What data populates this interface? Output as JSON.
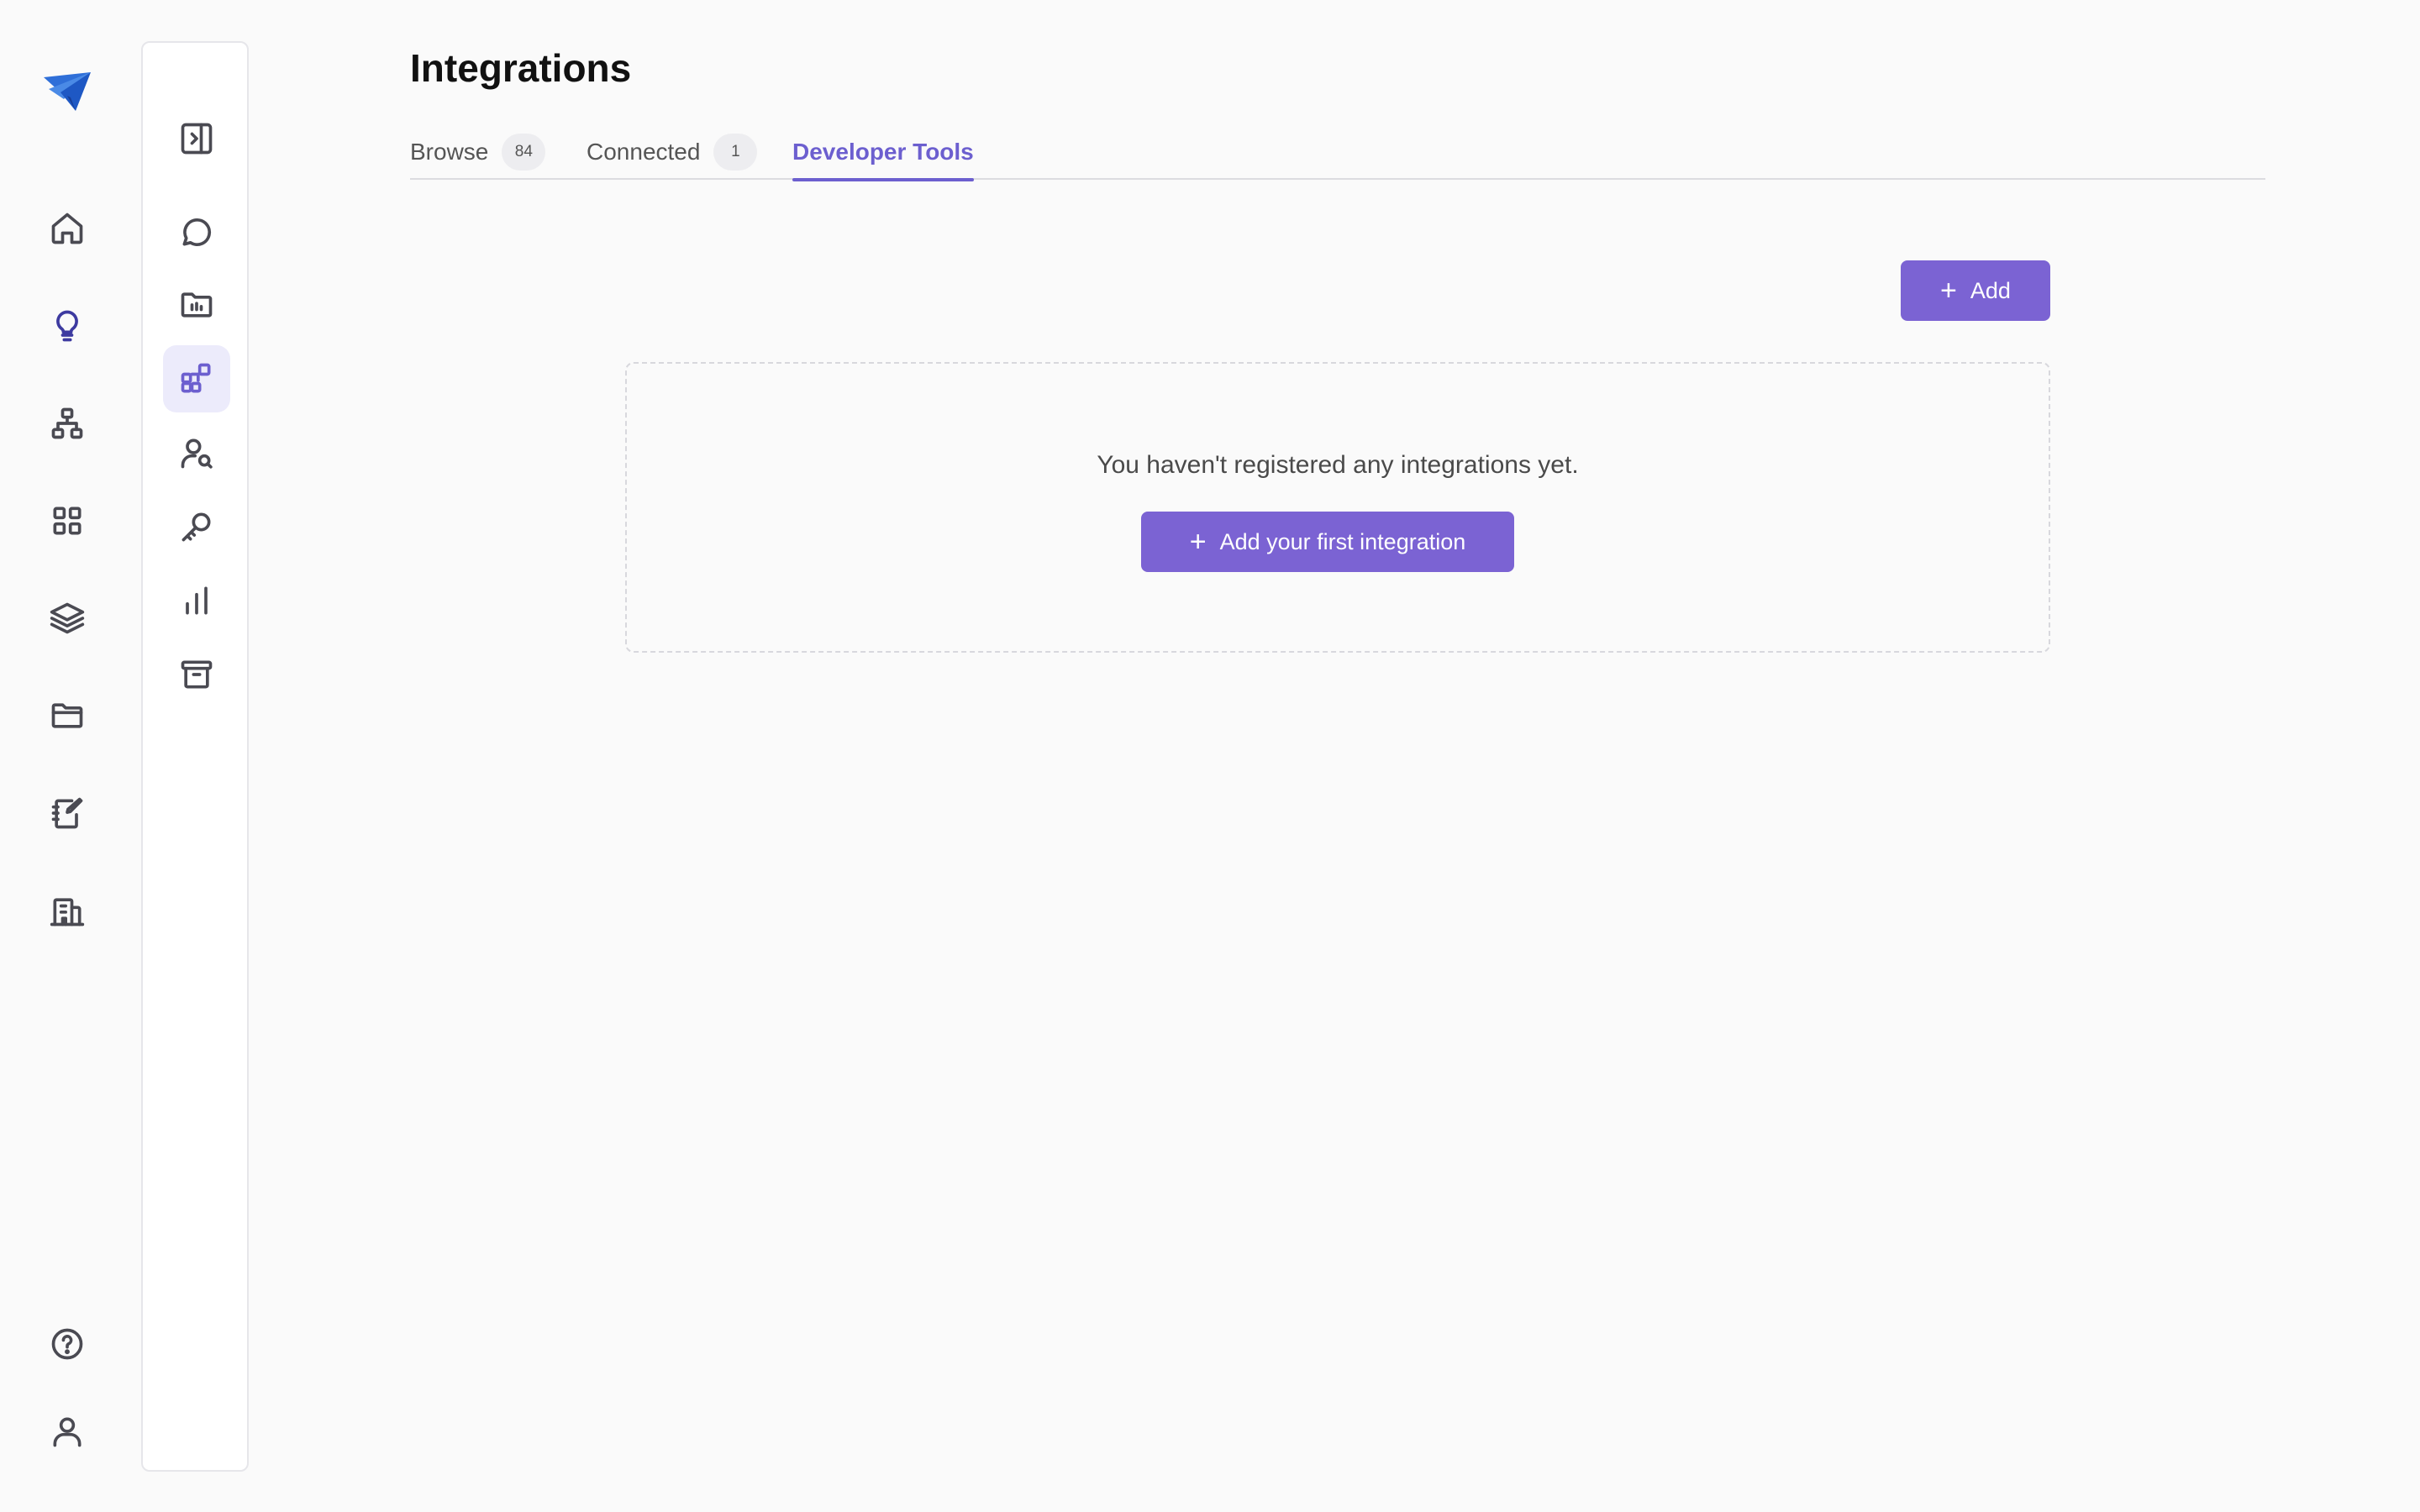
{
  "rail": {
    "logo": "paper-plane-logo",
    "items": [
      {
        "icon": "home-icon"
      },
      {
        "icon": "lightbulb-icon",
        "active": true
      },
      {
        "icon": "org-chart-icon"
      },
      {
        "icon": "apps-grid-icon"
      },
      {
        "icon": "layers-icon"
      },
      {
        "icon": "folder-icon"
      },
      {
        "icon": "notebook-edit-icon"
      },
      {
        "icon": "building-icon"
      }
    ],
    "bottom": [
      {
        "icon": "help-circle-icon"
      },
      {
        "icon": "user-icon"
      }
    ]
  },
  "panel": {
    "items": [
      {
        "icon": "sidebar-toggle-icon"
      },
      {
        "icon": "chat-bubble-icon"
      },
      {
        "icon": "folder-chart-icon"
      },
      {
        "icon": "integrations-icon",
        "active": true
      },
      {
        "icon": "user-search-icon"
      },
      {
        "icon": "key-icon"
      },
      {
        "icon": "bar-chart-icon"
      },
      {
        "icon": "archive-icon"
      }
    ]
  },
  "page": {
    "title": "Integrations",
    "tabs": [
      {
        "label": "Browse",
        "count": "84"
      },
      {
        "label": "Connected",
        "count": "1"
      },
      {
        "label": "Developer Tools",
        "active": true
      }
    ],
    "add_label": "Add",
    "empty_message": "You haven't registered any integrations yet.",
    "empty_cta_label": "Add your first integration"
  },
  "colors": {
    "accent": "#7b63d3",
    "accent_text": "#6c5fcf",
    "background": "#fafafa"
  }
}
